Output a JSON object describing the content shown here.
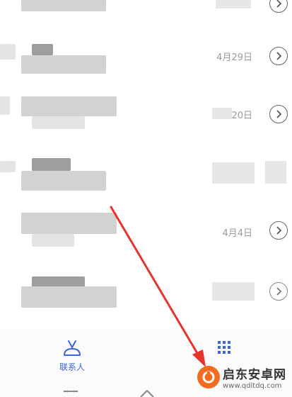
{
  "call_log": {
    "rows": [
      {
        "date": ""
      },
      {
        "date": "4月29日"
      },
      {
        "date": "20日"
      },
      {
        "date": ""
      },
      {
        "date": "4月4日"
      },
      {
        "date": ""
      }
    ]
  },
  "tabbar": {
    "contacts_label": "联系人"
  },
  "icons": {
    "info": "chevron-right-circle-icon",
    "contacts": "contacts-person-icon",
    "dialpad": "dialpad-grid-icon"
  },
  "colors": {
    "accent": "#3a66d9",
    "arrow": "#e8322c",
    "watermark_logo": "#f26b21"
  },
  "watermark": {
    "text": "启东安卓网",
    "url": "www.qdltdq.com"
  }
}
